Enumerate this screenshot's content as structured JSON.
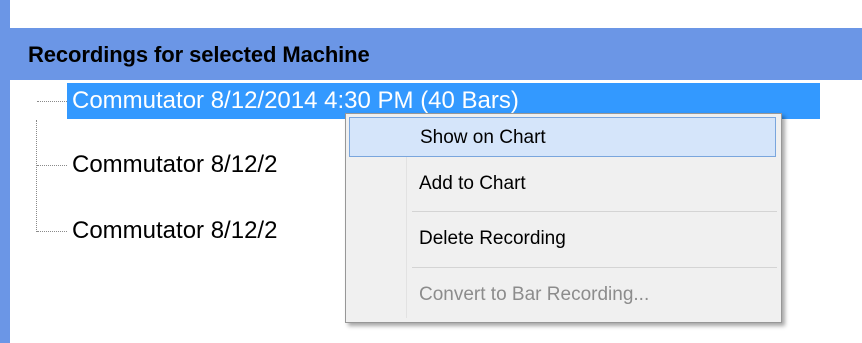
{
  "panel": {
    "title": "Recordings for selected Machine"
  },
  "tree": {
    "items": [
      {
        "label": "Commutator 8/12/2014 4:30 PM (40 Bars)",
        "selected": true
      },
      {
        "label": "Commutator 8/12/2",
        "selected": false
      },
      {
        "label": "Commutator 8/12/2",
        "selected": false
      }
    ]
  },
  "context_menu": {
    "items": [
      {
        "label": "Show on Chart",
        "highlighted": true,
        "enabled": true
      },
      {
        "label": "Add to Chart",
        "highlighted": false,
        "enabled": true
      },
      {
        "label": "Delete Recording",
        "highlighted": false,
        "enabled": true
      },
      {
        "label": "Convert to Bar Recording...",
        "highlighted": false,
        "enabled": false
      }
    ]
  },
  "colors": {
    "header_bg": "#6b96e6",
    "selection": "#3399ff",
    "menu_highlight": "#d5e5fa",
    "disabled_text": "#8c8c8c"
  }
}
